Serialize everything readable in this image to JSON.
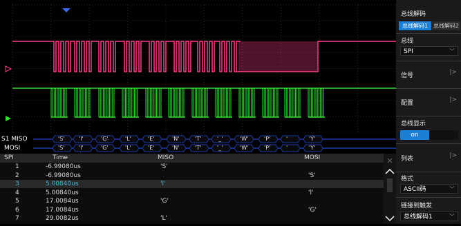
{
  "colors": {
    "ch1": "#ff3e8e",
    "ch2": "#2fe02f",
    "accent": "#1c7fd6",
    "trigger_marker": "#3a6cf0",
    "bus": "#1c3aa8"
  },
  "scope": {
    "trigger_icon": "triangle-down-icon",
    "ch1_marker": "ch1-level-marker-icon",
    "ch2_marker": "ch2-level-marker-icon"
  },
  "decode": {
    "bus_prefix": "S1",
    "miso_label": "MISO",
    "mosi_label": "MOSI",
    "miso_values": [
      "'S'",
      "'l'",
      "'G'",
      "'L'",
      "'E'",
      "'N'",
      "'T'",
      "'_'",
      "'W'",
      "'P'",
      "'",
      "'Y'"
    ],
    "mosi_values": [
      "'S'",
      "'l'",
      "'G'",
      "'L'",
      "'E'",
      "'N'",
      "'T'",
      "'_'",
      "'W'",
      "'P'",
      "'",
      "'Y'"
    ]
  },
  "table": {
    "headers": [
      "SPI",
      "Time",
      "MISO",
      "MOSI"
    ],
    "rows": [
      {
        "n": "1",
        "time": "-6.99080us",
        "miso": "'S'",
        "mosi": ""
      },
      {
        "n": "2",
        "time": "-6.99080us",
        "miso": "",
        "mosi": "'S'"
      },
      {
        "n": "3",
        "time": "5.00840us",
        "miso": "'l'",
        "mosi": ""
      },
      {
        "n": "4",
        "time": "5.00840us",
        "miso": "",
        "mosi": "'l'"
      },
      {
        "n": "5",
        "time": "17.0084us",
        "miso": "'G'",
        "mosi": ""
      },
      {
        "n": "6",
        "time": "17.0084us",
        "miso": "",
        "mosi": "'G'"
      },
      {
        "n": "7",
        "time": "29.0082us",
        "miso": "'L'",
        "mosi": ""
      }
    ],
    "selected_row": 2
  },
  "panel": {
    "title": "总线解码",
    "tab1": "总线解码1",
    "tab2": "总线解码2",
    "bus_label": "总线",
    "bus_value": "SPI",
    "signal_label": "信号",
    "config_label": "配置",
    "display_label": "总线显示",
    "display_value": "on",
    "list_label": "列表",
    "format_label": "格式",
    "format_value": "ASCII码",
    "link_label": "链接到触发",
    "link_value": "总线解码1"
  }
}
